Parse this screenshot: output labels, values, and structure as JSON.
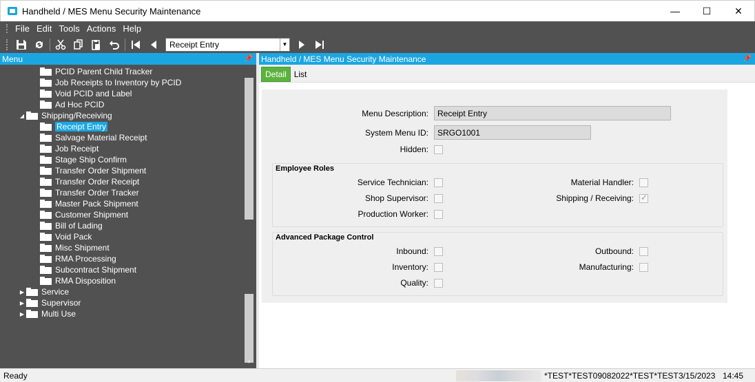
{
  "window": {
    "title": "Handheld / MES Menu Security Maintenance",
    "controls": {
      "minimize": "—",
      "maximize": "☐",
      "close": "✕"
    }
  },
  "menubar": {
    "items": [
      "File",
      "Edit",
      "Tools",
      "Actions",
      "Help"
    ]
  },
  "toolbar": {
    "icons": [
      "save-icon",
      "refresh-icon",
      "cut-icon",
      "copy-icon",
      "paste-icon",
      "undo-icon",
      "first-record-icon",
      "previous-record-icon",
      "next-record-icon",
      "last-record-icon"
    ],
    "combo_value": "Receipt Entry"
  },
  "left_panel": {
    "title": "Menu",
    "tree": [
      {
        "level": 2,
        "label": "PCID Parent Child Tracker"
      },
      {
        "level": 2,
        "label": "Job Receipts to Inventory by PCID"
      },
      {
        "level": 2,
        "label": "Void PCID and Label"
      },
      {
        "level": 2,
        "label": "Ad Hoc PCID"
      },
      {
        "level": 1,
        "label": "Shipping/Receiving",
        "expanded": true
      },
      {
        "level": 2,
        "label": "Receipt Entry",
        "selected": true
      },
      {
        "level": 2,
        "label": "Salvage Material Receipt"
      },
      {
        "level": 2,
        "label": "Job Receipt"
      },
      {
        "level": 2,
        "label": "Stage Ship Confirm"
      },
      {
        "level": 2,
        "label": "Transfer Order Shipment"
      },
      {
        "level": 2,
        "label": "Transfer Order Receipt"
      },
      {
        "level": 2,
        "label": "Transfer Order Tracker"
      },
      {
        "level": 2,
        "label": "Master Pack Shipment"
      },
      {
        "level": 2,
        "label": "Customer Shipment"
      },
      {
        "level": 2,
        "label": "Bill of Lading"
      },
      {
        "level": 2,
        "label": "Void Pack"
      },
      {
        "level": 2,
        "label": "Misc Shipment"
      },
      {
        "level": 2,
        "label": "RMA Processing"
      },
      {
        "level": 2,
        "label": "Subcontract Shipment"
      },
      {
        "level": 2,
        "label": "RMA Disposition"
      },
      {
        "level": 1,
        "label": "Service",
        "expanded": false
      },
      {
        "level": 1,
        "label": "Supervisor",
        "expanded": false
      },
      {
        "level": 1,
        "label": "Multi Use",
        "expanded": false
      }
    ]
  },
  "right_panel": {
    "title": "Handheld / MES Menu Security Maintenance",
    "tabs": [
      {
        "label": "Detail",
        "active": true
      },
      {
        "label": "List",
        "active": false
      }
    ],
    "form": {
      "menu_description_label": "Menu Description:",
      "menu_description_value": "Receipt Entry",
      "system_menu_id_label": "System Menu ID:",
      "system_menu_id_value": "SRGO1001",
      "hidden_label": "Hidden:",
      "hidden_checked": false
    },
    "employee_roles": {
      "title": "Employee Roles",
      "service_technician": "Service Technician:",
      "shop_supervisor": "Shop Supervisor:",
      "production_worker": "Production Worker:",
      "material_handler": "Material Handler:",
      "shipping_receiving": "Shipping / Receiving:",
      "shipping_receiving_checked": true
    },
    "advanced_package_control": {
      "title": "Advanced Package Control",
      "inbound": "Inbound:",
      "inventory": "Inventory:",
      "quality": "Quality:",
      "outbound": "Outbound:",
      "manufacturing": "Manufacturing:"
    }
  },
  "statusbar": {
    "status": "Ready",
    "environment": "*TEST*TEST09082022*TEST*TEST",
    "date": "3/15/2023",
    "time": "14:45"
  }
}
